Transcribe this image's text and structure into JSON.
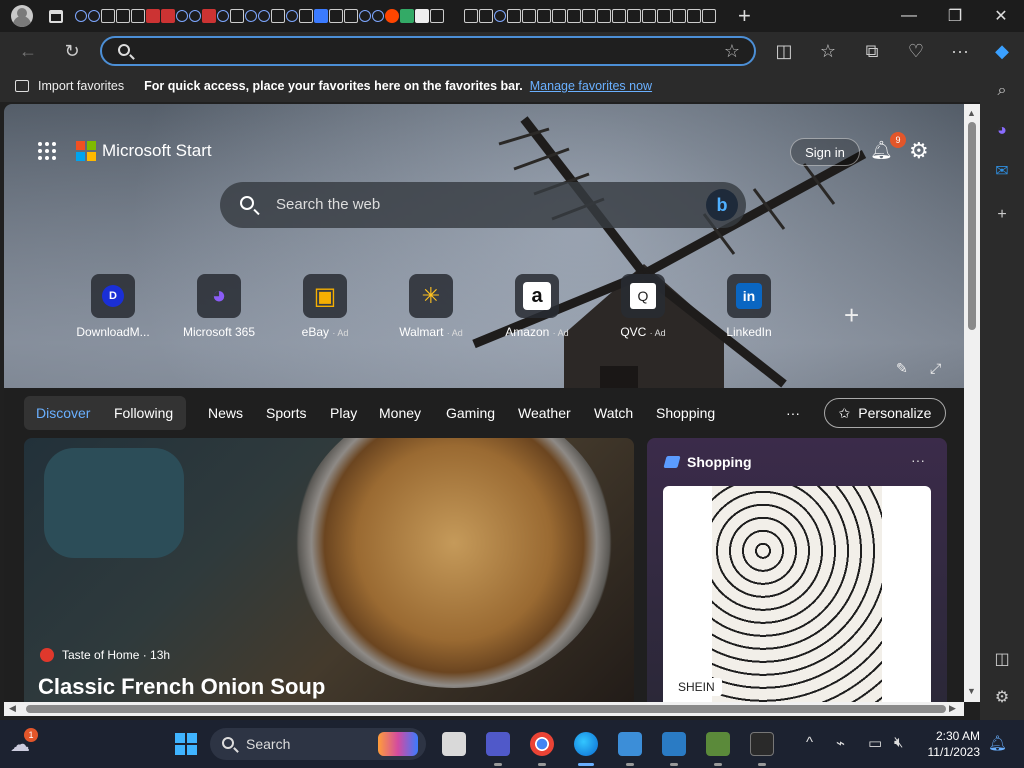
{
  "toolbar": {
    "star_icon": "star-outline-icon"
  },
  "favorites_bar": {
    "import_label": "Import favorites",
    "message": "For quick access, place your favorites here on the favorites bar.",
    "manage_link": "Manage favorites now"
  },
  "ms_start": {
    "title": "Microsoft Start",
    "sign_in": "Sign in",
    "notification_count": "9",
    "search_placeholder": "Search the web",
    "bing_label": "b"
  },
  "quick_links": [
    {
      "label": "DownloadM...",
      "ad": "",
      "glyph": "D",
      "color": "#1a2fd6"
    },
    {
      "label": "Microsoft 365",
      "ad": "",
      "glyph": "◕",
      "color": "#7b4fe0"
    },
    {
      "label": "eBay",
      "ad": "· Ad",
      "glyph": "▣",
      "color": "#e53238"
    },
    {
      "label": "Walmart",
      "ad": "· Ad",
      "glyph": "✳",
      "color": "#0071dc"
    },
    {
      "label": "Amazon",
      "ad": "· Ad",
      "glyph": "a",
      "color": "#ffffff"
    },
    {
      "label": "QVC",
      "ad": "· Ad",
      "glyph": "Q",
      "color": "#ffffff"
    },
    {
      "label": "LinkedIn",
      "ad": "",
      "glyph": "in",
      "color": "#0a66c2"
    }
  ],
  "feed_nav": {
    "tabs": [
      "Discover",
      "Following",
      "News",
      "Sports",
      "Play",
      "Money",
      "Gaming",
      "Weather",
      "Watch",
      "Shopping"
    ],
    "more": "···",
    "personalize": "Personalize"
  },
  "story": {
    "source": "Taste of Home · 13h",
    "headline": "Classic French Onion Soup"
  },
  "shopping": {
    "title": "Shopping",
    "more": "···",
    "brand": "SHEIN"
  },
  "taskbar": {
    "search_label": "Search",
    "weather_badge": "1",
    "time": "2:30 AM",
    "date": "11/1/2023"
  }
}
